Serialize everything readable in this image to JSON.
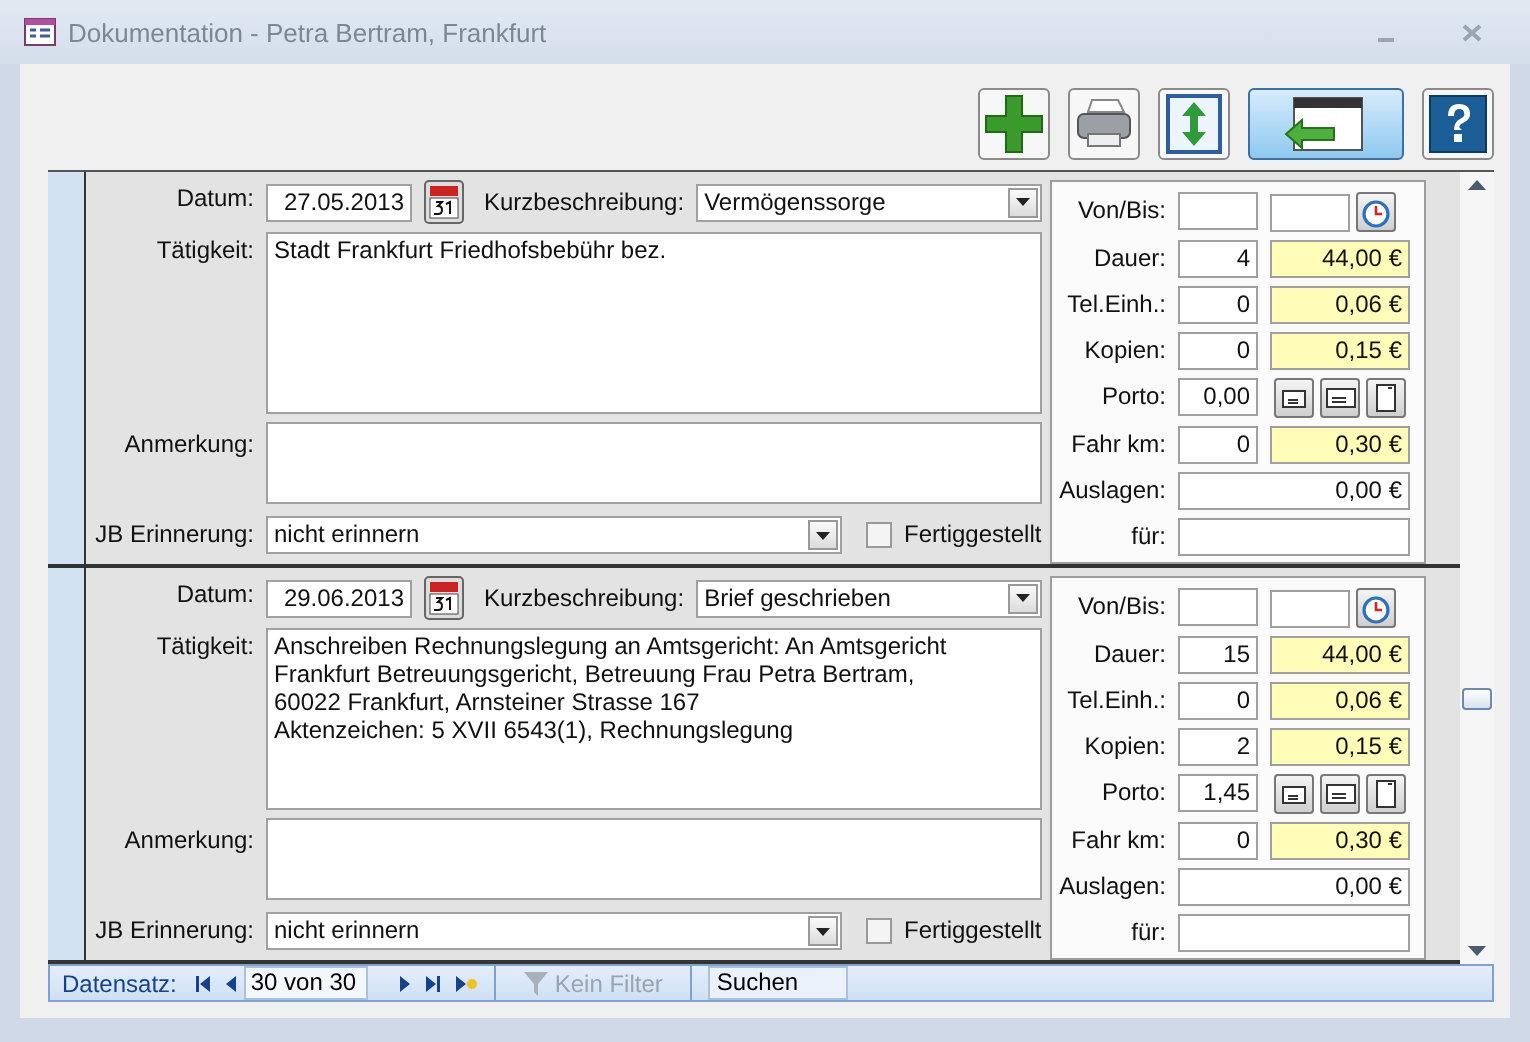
{
  "window": {
    "title": "Dokumentation - Petra Bertram, Frankfurt"
  },
  "toolbar": [
    {
      "kind": "add",
      "selected": false
    },
    {
      "kind": "print",
      "selected": false
    },
    {
      "kind": "resize",
      "selected": false
    },
    {
      "kind": "back",
      "selected": true
    },
    {
      "kind": "help",
      "selected": false
    }
  ],
  "records": [
    {
      "datum_label": "Datum:",
      "datum": "27.05.2013",
      "kurz_label": "Kurzbeschreibung:",
      "kurz": "Vermögenssorge",
      "taetigkeit_label": "Tätigkeit:",
      "taetigkeit": "Stadt Frankfurt Friedhofsbebühr bez.",
      "anmerkung_label": "Anmerkung:",
      "erinnerung_label": "JB Erinnerung:",
      "erinnerung": "nicht erinnern",
      "fertig_label": "Fertiggestellt",
      "fertig_checked": false,
      "costs": [
        {
          "kind": "time",
          "label": "Von/Bis:"
        },
        {
          "kind": "amount",
          "label": "Dauer:",
          "count": "4",
          "price": "44,00 €"
        },
        {
          "kind": "amount",
          "label": "Tel.Einh.:",
          "count": "0",
          "price": "0,06 €"
        },
        {
          "kind": "amount",
          "label": "Kopien:",
          "count": "0",
          "price": "0,15 €"
        },
        {
          "kind": "porto",
          "label": "Porto:",
          "count": "0,00"
        },
        {
          "kind": "amount",
          "label": "Fahr km:",
          "count": "0",
          "price": "0,30 €"
        },
        {
          "kind": "total",
          "label": "Auslagen:",
          "value": "0,00 €"
        },
        {
          "kind": "total",
          "label": "für:"
        }
      ]
    },
    {
      "datum_label": "Datum:",
      "datum": "29.06.2013",
      "kurz_label": "Kurzbeschreibung:",
      "kurz": "Brief geschrieben",
      "taetigkeit_label": "Tätigkeit:",
      "taetigkeit": "Anschreiben Rechnungslegung an Amtsgericht: An Amtsgericht\nFrankfurt Betreuungsgericht, Betreuung Frau Petra Bertram,\n60022 Frankfurt, Arnsteiner Strasse 167\nAktenzeichen: 5 XVII 6543(1), Rechnungslegung",
      "anmerkung_label": "Anmerkung:",
      "erinnerung_label": "JB Erinnerung:",
      "erinnerung": "nicht erinnern",
      "fertig_label": "Fertiggestellt",
      "fertig_checked": false,
      "costs": [
        {
          "kind": "time",
          "label": "Von/Bis:"
        },
        {
          "kind": "amount",
          "label": "Dauer:",
          "count": "15",
          "price": "44,00 €"
        },
        {
          "kind": "amount",
          "label": "Tel.Einh.:",
          "count": "0",
          "price": "0,06 €"
        },
        {
          "kind": "amount",
          "label": "Kopien:",
          "count": "2",
          "price": "0,15 €"
        },
        {
          "kind": "porto",
          "label": "Porto:",
          "count": "1,45"
        },
        {
          "kind": "amount",
          "label": "Fahr km:",
          "count": "0",
          "price": "0,30 €"
        },
        {
          "kind": "total",
          "label": "Auslagen:",
          "value": "0,00 €"
        },
        {
          "kind": "total",
          "label": "für:"
        }
      ]
    }
  ],
  "nav": {
    "label": "Datensatz:",
    "position": "30 von 30",
    "filter": "Kein Filter",
    "filter_disabled": true,
    "search": "Suchen"
  }
}
